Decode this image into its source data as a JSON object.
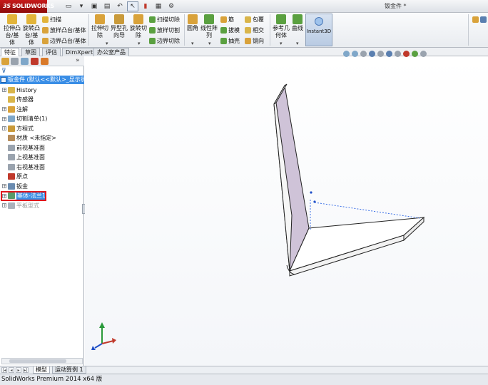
{
  "app": {
    "logo_text": "SOLIDWORKS",
    "logo_mark": "3S",
    "document_title": "钣金件 *"
  },
  "quick_access": [
    "new-icon",
    "open-icon",
    "save-icon",
    "print-icon",
    "undo-icon",
    "select-icon",
    "rebuild-icon",
    "file-props-icon",
    "options-icon"
  ],
  "command_manager": {
    "extrude_boss": "拉伸凸\n台/基\n体",
    "revolve_boss": "旋转凸\n台/基\n体",
    "sweep": "扫描",
    "loft_boss": "放样凸台/基体",
    "boundary_boss": "边界凸台/基体",
    "extrude_cut": "拉伸切\n除",
    "hole_wizard": "异型孔\n向导",
    "revolve_cut": "旋转切\n除",
    "sweep_cut": "扫描切除",
    "loft_cut": "放样切割",
    "boundary_cut": "边界切除",
    "fillet": "圆角",
    "linear_pattern": "线性阵\n列",
    "rib": "筋",
    "draft": "拔模",
    "shell": "抽壳",
    "wrap": "包覆",
    "intersect": "相交",
    "mirror": "镜向",
    "ref_geometry": "参考几\n何体",
    "curves": "曲线",
    "instant3d": "Instant3D"
  },
  "tabs": [
    "特征",
    "草图",
    "评估",
    "DimXpert",
    "办公室产品"
  ],
  "tree": {
    "root": "钣金件 (默认<<默认>_显示状",
    "items": [
      {
        "label": "History",
        "expandable": true,
        "color": "#d9b54a"
      },
      {
        "label": "传感器",
        "expandable": false,
        "color": "#d9b54a"
      },
      {
        "label": "注解",
        "expandable": true,
        "color": "#d9a23a"
      },
      {
        "label": "切割清单(1)",
        "expandable": true,
        "color": "#7fa7c9"
      },
      {
        "label": "方程式",
        "expandable": true,
        "color": "#c99a3a"
      },
      {
        "label": "材质 <未指定>",
        "expandable": false,
        "color": "#b58c5a"
      },
      {
        "label": "前视基准面",
        "expandable": false,
        "color": "#9aa3ae"
      },
      {
        "label": "上视基准面",
        "expandable": false,
        "color": "#9aa3ae"
      },
      {
        "label": "右视基准面",
        "expandable": false,
        "color": "#9aa3ae"
      },
      {
        "label": "原点",
        "expandable": false,
        "color": "#c0392b"
      },
      {
        "label": "钣金",
        "expandable": true,
        "color": "#6a8bb0"
      },
      {
        "label": "基体-法兰1",
        "expandable": true,
        "color": "#5a9a6a",
        "selected": true
      },
      {
        "label": "平板型式",
        "expandable": true,
        "color": "#aab1bb",
        "grey": true
      }
    ]
  },
  "bottom_tabs": [
    "模型",
    "运动算例 1"
  ],
  "status": "SolidWorks Premium 2014 x64 版",
  "colors": {
    "accent": "#3a8ee6",
    "highlight_box": "#e0161c",
    "part_face": "#cfc3d8"
  }
}
